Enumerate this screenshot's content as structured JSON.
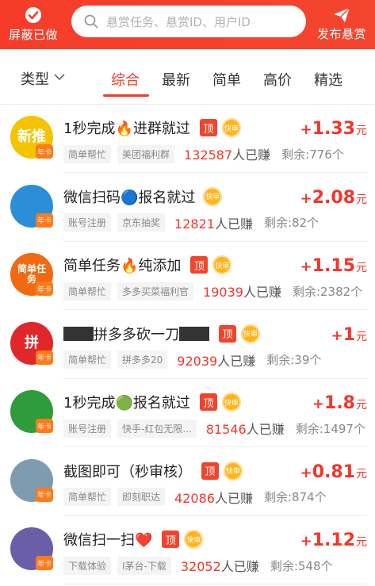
{
  "header": {
    "left_label": "屏蔽已做",
    "search_placeholder": "悬赏任务、悬赏ID、用户ID",
    "right_label": "发布悬赏"
  },
  "filter": {
    "type_label": "类型",
    "tabs": [
      "综合",
      "最新",
      "简单",
      "高价",
      "精选"
    ],
    "active_tab": "综合"
  },
  "labels": {
    "top": "顶",
    "fast": "快审",
    "earn_suffix": "人已赚",
    "remain_prefix": "剩余:",
    "yuan": "元",
    "plus": "+",
    "avatar_badge": "年卡"
  },
  "tasks": [
    {
      "title": "1秒完成🔥进群就过",
      "tags": [
        "简单帮忙",
        "美团福利群"
      ],
      "earned": "132587",
      "remain": "776个",
      "price": "1.33",
      "top": true,
      "fast": true,
      "avatar_text": "新推",
      "avatar_color": "#f5c400"
    },
    {
      "title": "微信扫码🔵报名就过",
      "tags": [
        "账号注册",
        "京东抽奖"
      ],
      "earned": "12821",
      "remain": "82个",
      "price": "2.08",
      "top": false,
      "fast": true,
      "avatar_text": "",
      "avatar_color": "#2d8ed8"
    },
    {
      "title": "简单任务🔥纯添加",
      "tags": [
        "简单帮忙",
        "多多买菜福利官"
      ],
      "earned": "19039",
      "remain": "2382个",
      "price": "1.15",
      "top": true,
      "fast": true,
      "avatar_text": "简单任务",
      "avatar_color": "#f06a12"
    },
    {
      "title": "拼多多砍一刀",
      "tags": [
        "简单帮忙",
        "拼多多20"
      ],
      "earned": "92039",
      "remain": "39个",
      "price": "1",
      "top": true,
      "fast": true,
      "avatar_text": "拼",
      "avatar_color": "#e0272b",
      "redacted": true
    },
    {
      "title": "1秒完成🟢报名就过",
      "tags": [
        "账号注册",
        "快手-红包无限..."
      ],
      "earned": "81546",
      "remain": "1497个",
      "price": "1.8",
      "top": true,
      "fast": true,
      "avatar_text": "",
      "avatar_color": "#2e9c3a"
    },
    {
      "title": "截图即可（秒审核）",
      "tags": [
        "简单帮忙",
        "即刻职达"
      ],
      "earned": "42086",
      "remain": "874个",
      "price": "0.81",
      "top": true,
      "fast": true,
      "avatar_text": "",
      "avatar_color": "#7f9bb0"
    },
    {
      "title": "微信扫一扫❤️",
      "tags": [
        "下载体验",
        "I茅台-下载"
      ],
      "earned": "32052",
      "remain": "548个",
      "price": "1.12",
      "top": true,
      "fast": true,
      "avatar_text": "",
      "avatar_color": "#6a5ea8"
    }
  ],
  "colors": {
    "brand": "#f33b26",
    "price": "#f3352a"
  }
}
